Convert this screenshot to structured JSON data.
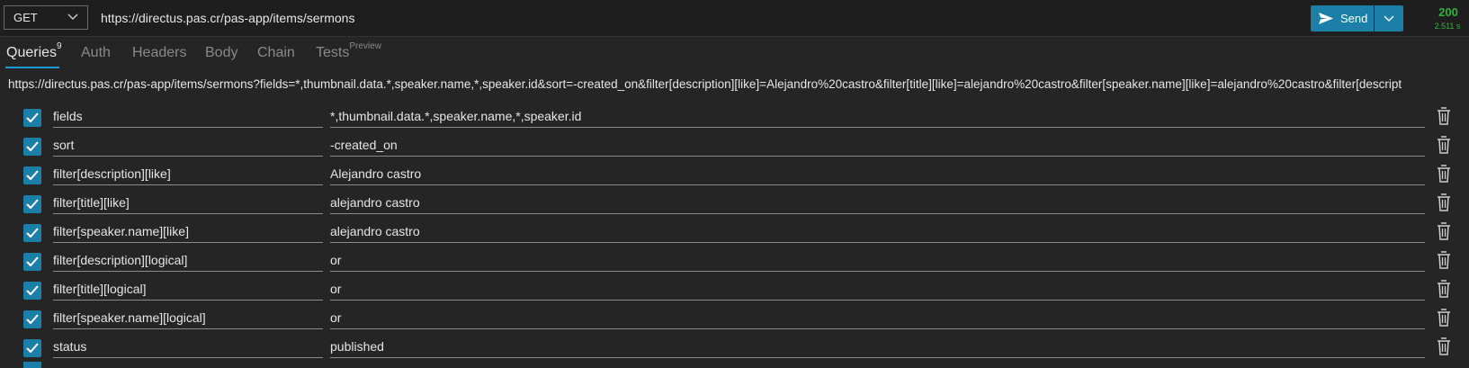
{
  "request": {
    "method": "GET",
    "url": "https://directus.pas.cr/pas-app/items/sermons",
    "send_label": "Send"
  },
  "response": {
    "status": "200",
    "time": "2.511 s"
  },
  "tabs": {
    "queries": "Queries",
    "queries_count": "9",
    "auth": "Auth",
    "headers": "Headers",
    "body": "Body",
    "chain": "Chain",
    "tests": "Tests",
    "tests_badge": "Preview"
  },
  "full_url": "https://directus.pas.cr/pas-app/items/sermons?fields=*,thumbnail.data.*,speaker.name,*,speaker.id&sort=-created_on&filter[description][like]=Alejandro%20castro&filter[title][like]=alejandro%20castro&filter[speaker.name][like]=alejandro%20castro&filter[descript",
  "params": [
    {
      "key": "fields",
      "value": "*,thumbnail.data.*,speaker.name,*,speaker.id",
      "checked": true
    },
    {
      "key": "sort",
      "value": "-created_on",
      "checked": true
    },
    {
      "key": "filter[description][like]",
      "value": "Alejandro castro",
      "checked": true
    },
    {
      "key": "filter[title][like]",
      "value": "alejandro castro",
      "checked": true
    },
    {
      "key": "filter[speaker.name][like]",
      "value": "alejandro castro",
      "checked": true
    },
    {
      "key": "filter[description][logical]",
      "value": "or",
      "checked": true
    },
    {
      "key": "filter[title][logical]",
      "value": "or",
      "checked": true
    },
    {
      "key": "filter[speaker.name][logical]",
      "value": "or",
      "checked": true
    },
    {
      "key": "status",
      "value": "published",
      "checked": true
    }
  ],
  "colors": {
    "accent": "#1c7fa8",
    "status_ok": "#2fb33e",
    "tab_underline": "#1c9ad6"
  },
  "icons": {
    "method_dropdown": "chevron-down-icon",
    "send": "send-icon",
    "send_dropdown": "chevron-down-icon",
    "checkbox": "checkmark-icon",
    "delete": "trash-icon"
  }
}
